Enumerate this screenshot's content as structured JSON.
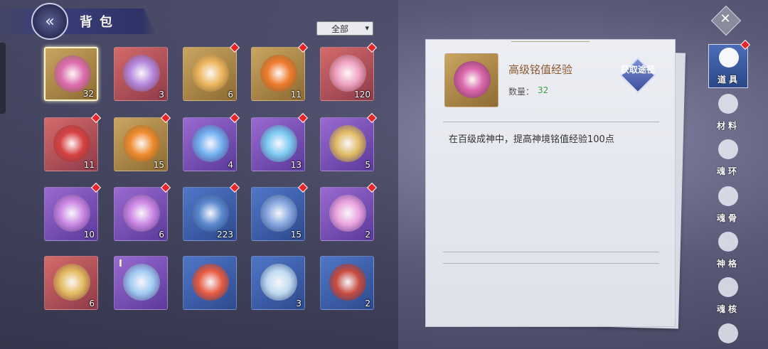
{
  "header": {
    "title": "背包",
    "back_icon": "double-chevron-left-icon"
  },
  "filter": {
    "selected": "全部"
  },
  "inventory": [
    {
      "qty": "32",
      "rarity": "gold",
      "selected": true,
      "badge": false,
      "item": "pink-rune-card",
      "color": "#e06ab5"
    },
    {
      "qty": "3",
      "rarity": "red",
      "badge": false,
      "item": "purple-rune-book",
      "color": "#b38ae6"
    },
    {
      "qty": "6",
      "rarity": "gold",
      "badge": true,
      "item": "golden-flame",
      "color": "#f0b860"
    },
    {
      "qty": "11",
      "rarity": "gold",
      "badge": true,
      "item": "orange-fire-orb",
      "color": "#f27a2a"
    },
    {
      "qty": "120",
      "rarity": "red",
      "badge": true,
      "item": "pink-coin",
      "color": "#f2a6c6"
    },
    {
      "qty": "11",
      "rarity": "red",
      "badge": true,
      "item": "yin-yang-bead",
      "color": "#d94040"
    },
    {
      "qty": "15",
      "rarity": "gold",
      "badge": true,
      "item": "fire-orb",
      "color": "#f28a2a"
    },
    {
      "qty": "4",
      "rarity": "purple",
      "badge": true,
      "item": "blue-crystal-horn",
      "color": "#6fb4f2"
    },
    {
      "qty": "13",
      "rarity": "purple",
      "badge": true,
      "item": "water-swirl-orb",
      "color": "#7ad0f5"
    },
    {
      "qty": "5",
      "rarity": "purple",
      "badge": true,
      "item": "treasure-chest",
      "color": "#e6c060"
    },
    {
      "qty": "10",
      "rarity": "purple",
      "badge": true,
      "item": "violet-mask",
      "color": "#d08ae6"
    },
    {
      "qty": "6",
      "rarity": "purple",
      "badge": true,
      "item": "violet-mask",
      "color": "#d08ae6"
    },
    {
      "qty": "223",
      "rarity": "blue",
      "badge": true,
      "item": "mystery-bubble",
      "color": "#5c8ad0"
    },
    {
      "qty": "15",
      "rarity": "blue",
      "badge": true,
      "item": "mystery-horn",
      "color": "#8aaae0"
    },
    {
      "qty": "2",
      "rarity": "purple",
      "badge": true,
      "item": "lotus-flower",
      "color": "#f0a6e0"
    },
    {
      "qty": "6",
      "rarity": "red",
      "badge": false,
      "item": "golden-key",
      "color": "#e6c060"
    },
    {
      "qty": "",
      "rarity": "purple",
      "badge": false,
      "item": "crystal-sphere",
      "color": "#a0d0f5",
      "tag": "I"
    },
    {
      "qty": "",
      "rarity": "blue",
      "badge": false,
      "item": "flame-emblem",
      "color": "#f05a3a"
    },
    {
      "qty": "3",
      "rarity": "blue",
      "badge": false,
      "item": "spirit-beast",
      "color": "#c6e0f5"
    },
    {
      "qty": "2",
      "rarity": "blue",
      "badge": false,
      "item": "red-spellbook",
      "color": "#d04a3a"
    }
  ],
  "detail": {
    "name": "高级铭值经验",
    "qty_label": "数量：",
    "qty_value": "32",
    "source_button": "获取途径",
    "description": "在百级成神中，提高神境铭值经验100点"
  },
  "tabs": [
    {
      "label": "道具",
      "icon": "feather-icon",
      "active": true,
      "badge": true
    },
    {
      "label": "材料",
      "icon": "ore-icon",
      "active": false,
      "badge": false
    },
    {
      "label": "魂环",
      "icon": "ring-icon",
      "active": false,
      "badge": false
    },
    {
      "label": "魂骨",
      "icon": "bone-wing-icon",
      "active": false,
      "badge": false
    },
    {
      "label": "神格",
      "icon": "divine-sigil-icon",
      "active": false,
      "badge": false
    },
    {
      "label": "魂核",
      "icon": "soul-core-icon",
      "active": false,
      "badge": false
    }
  ],
  "colors": {
    "accent": "#3a3f7a",
    "badge": "#e8262a",
    "qty_green": "#3aa63a",
    "name_brown": "#8a5a2e"
  }
}
